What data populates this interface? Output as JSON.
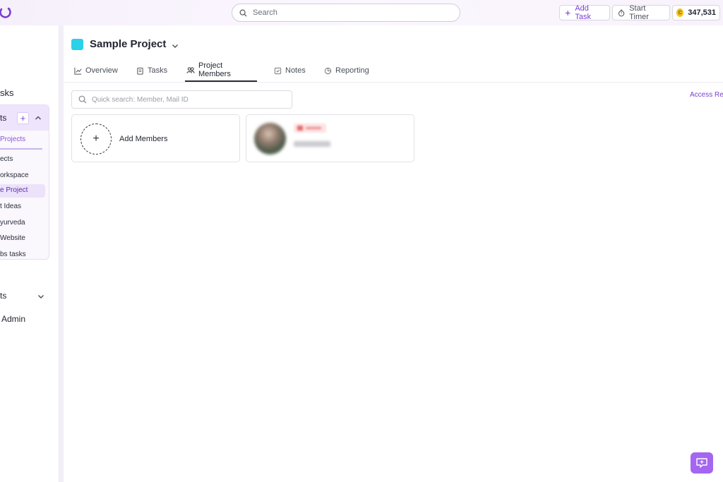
{
  "topbar": {
    "search_placeholder": "Search",
    "add_task_label": "Add Task",
    "start_timer_label": "Start Timer",
    "coins_value": "347,531",
    "coin_symbol": "C"
  },
  "sidebar": {
    "tasks_label": "sks",
    "projects_group_label": "ts",
    "projects_sub_label": "Projects",
    "items": [
      {
        "label": "ects",
        "active": false
      },
      {
        "label": "orkspace",
        "active": false
      },
      {
        "label": "e Project",
        "active": true
      },
      {
        "label": "t Ideas",
        "active": false
      },
      {
        "label": "yurveda",
        "active": false
      },
      {
        "label": "Website",
        "active": false
      },
      {
        "label": "bs tasks",
        "active": false
      }
    ],
    "reports_label": "ts",
    "admin_label": "Admin"
  },
  "project": {
    "title": "Sample Project",
    "color": "#2bd1e8"
  },
  "tabs": [
    {
      "label": "Overview",
      "icon": "chart-line-icon",
      "active": false
    },
    {
      "label": "Tasks",
      "icon": "clipboard-icon",
      "active": false
    },
    {
      "label": "Project Members",
      "icon": "users-icon",
      "active": true
    },
    {
      "label": "Notes",
      "icon": "note-icon",
      "active": false
    },
    {
      "label": "Reporting",
      "icon": "pie-chart-icon",
      "active": false
    }
  ],
  "members": {
    "search_placeholder": "Quick search: Member, Mail ID",
    "access_link": "Access Re",
    "add_members_label": "Add Members"
  },
  "colors": {
    "accent": "#7a3fd1",
    "fab": "#a466f0"
  }
}
